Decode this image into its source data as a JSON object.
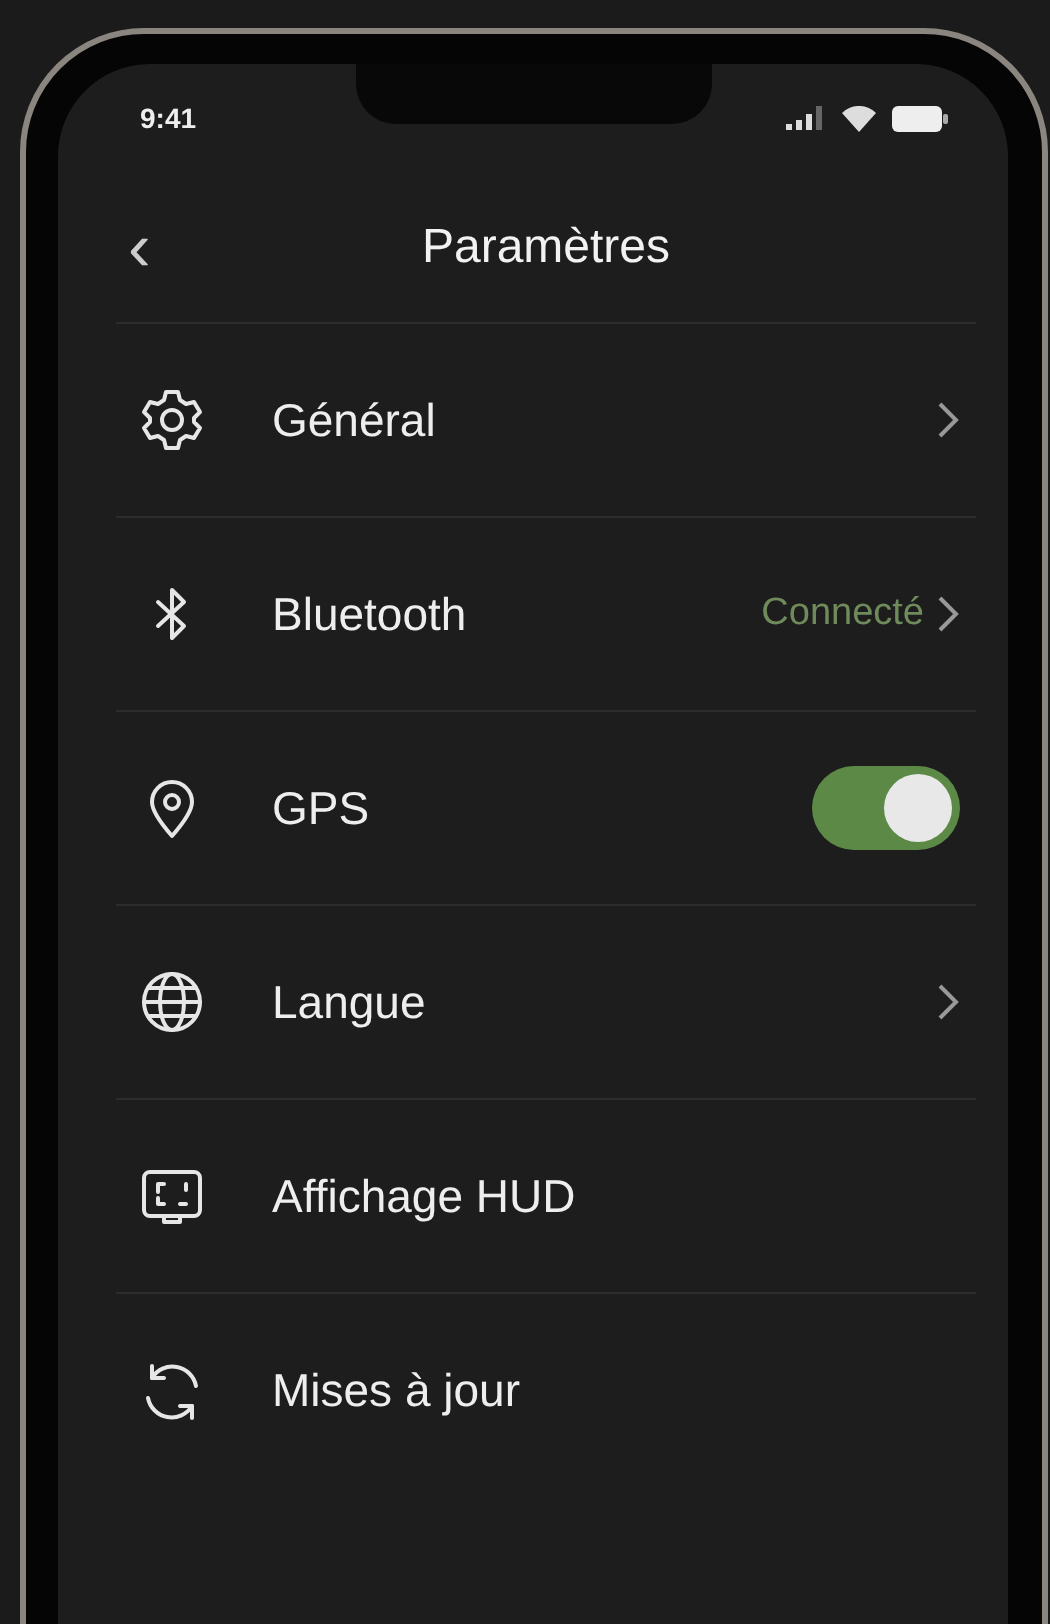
{
  "status_bar": {
    "time": "9:41"
  },
  "header": {
    "back": "‹",
    "title": "Paramètres"
  },
  "items": [
    {
      "label": "Général",
      "kind": "chevron"
    },
    {
      "label": "Bluetooth",
      "kind": "chevron",
      "value": "Connecté"
    },
    {
      "label": "GPS",
      "kind": "toggle",
      "on": true
    },
    {
      "label": "Langue",
      "kind": "chevron"
    },
    {
      "label": "Affichage HUD",
      "kind": "plain"
    },
    {
      "label": "Mises à jour",
      "kind": "plain"
    }
  ]
}
